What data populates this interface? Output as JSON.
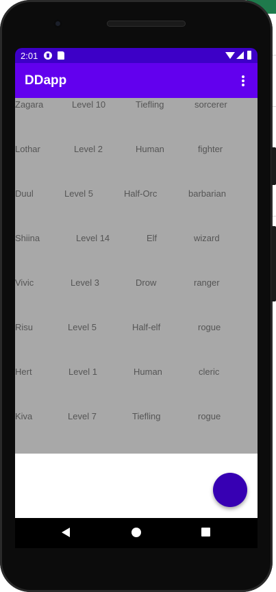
{
  "status_bar": {
    "time": "2:01"
  },
  "app_bar": {
    "title": "DDapp"
  },
  "characters": [
    {
      "name": "Zagara",
      "level": "Level 10",
      "race": "Tiefling",
      "class": "sorcerer"
    },
    {
      "name": "Lothar",
      "level": "Level 2",
      "race": "Human",
      "class": "fighter"
    },
    {
      "name": "Duul",
      "level": "Level 5",
      "race": "Half-Orc",
      "class": "barbarian"
    },
    {
      "name": "Shiina",
      "level": "Level 14",
      "race": "Elf",
      "class": "wizard"
    },
    {
      "name": "Vivic",
      "level": "Level 3",
      "race": "Drow",
      "class": "ranger"
    },
    {
      "name": "Risu",
      "level": "Level 5",
      "race": "Half-elf",
      "class": "rogue"
    },
    {
      "name": "Hert",
      "level": "Level 1",
      "race": "Human",
      "class": "cleric"
    },
    {
      "name": "Kiva",
      "level": "Level 7",
      "race": "Tiefling",
      "class": "rogue"
    }
  ],
  "colors": {
    "status_bar": "#3d00c7",
    "app_bar": "#6200ee",
    "list_background": "#a8a8a8",
    "fab": "#3700b3"
  },
  "icons": {
    "overflow": "more-vert-icon",
    "fab": "fab-button",
    "nav_back": "back-icon",
    "nav_home": "home-icon",
    "nav_recents": "recents-icon"
  }
}
